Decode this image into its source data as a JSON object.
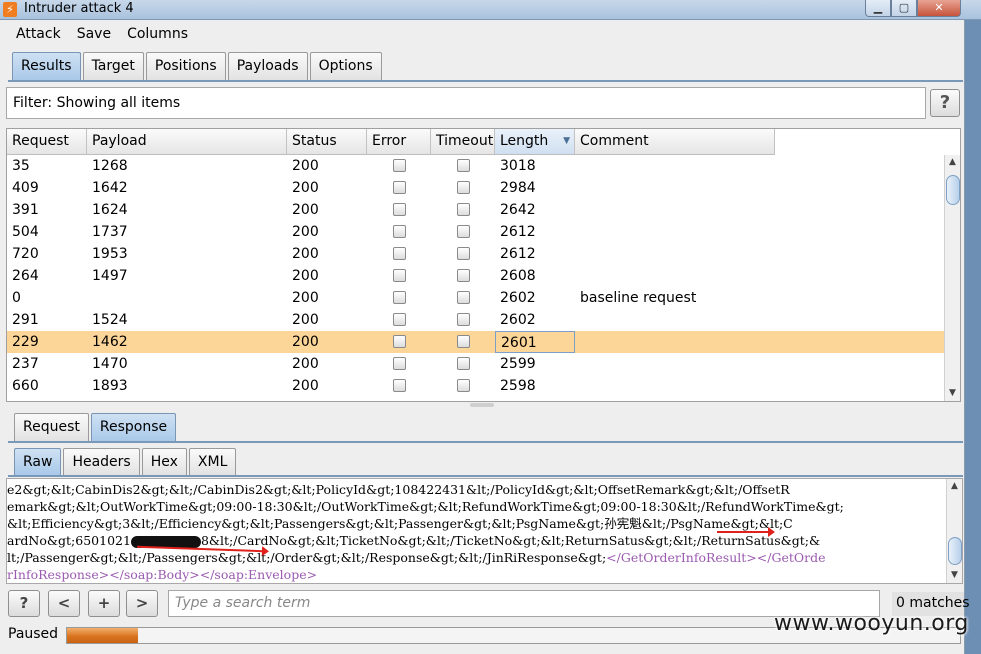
{
  "window": {
    "title": "Intruder attack 4",
    "app_icon": "burp-lightning-icon"
  },
  "menubar": [
    "Attack",
    "Save",
    "Columns"
  ],
  "top_tabs": [
    "Results",
    "Target",
    "Positions",
    "Payloads",
    "Options"
  ],
  "filter": {
    "text": "Filter: Showing all items",
    "help_label": "?"
  },
  "table": {
    "columns": [
      "Request",
      "Payload",
      "Status",
      "Error",
      "Timeout",
      "Length",
      "Comment"
    ],
    "sorted_column": "Length",
    "rows": [
      {
        "request": "35",
        "payload": "1268",
        "status": "200",
        "length": "3018",
        "comment": ""
      },
      {
        "request": "409",
        "payload": "1642",
        "status": "200",
        "length": "2984",
        "comment": ""
      },
      {
        "request": "391",
        "payload": "1624",
        "status": "200",
        "length": "2642",
        "comment": ""
      },
      {
        "request": "504",
        "payload": "1737",
        "status": "200",
        "length": "2612",
        "comment": ""
      },
      {
        "request": "720",
        "payload": "1953",
        "status": "200",
        "length": "2612",
        "comment": ""
      },
      {
        "request": "264",
        "payload": "1497",
        "status": "200",
        "length": "2608",
        "comment": ""
      },
      {
        "request": "0",
        "payload": "",
        "status": "200",
        "length": "2602",
        "comment": "baseline request"
      },
      {
        "request": "291",
        "payload": "1524",
        "status": "200",
        "length": "2602",
        "comment": ""
      },
      {
        "request": "229",
        "payload": "1462",
        "status": "200",
        "length": "2601",
        "comment": "",
        "selected": true
      },
      {
        "request": "237",
        "payload": "1470",
        "status": "200",
        "length": "2599",
        "comment": ""
      },
      {
        "request": "660",
        "payload": "1893",
        "status": "200",
        "length": "2598",
        "comment": ""
      }
    ]
  },
  "mid_tabs": [
    "Request",
    "Response"
  ],
  "sub_tabs": [
    "Raw",
    "Headers",
    "Hex",
    "XML"
  ],
  "response": {
    "line1": "e2&gt;&lt;CabinDis2&gt;&lt;/CabinDis2&gt;&lt;PolicyId&gt;108422431&lt;/PolicyId&gt;&lt;OffsetRemark&gt;&lt;/OffsetR",
    "line2": "emark&gt;&lt;OutWorkTime&gt;09:00-18:30&lt;/OutWorkTime&gt;&lt;RefundWorkTime&gt;09:00-18:30&lt;/RefundWorkTime&gt;",
    "line3": "&lt;Efficiency&gt;3&lt;/Efficiency&gt;&lt;Passengers&gt;&lt;Passenger&gt;&lt;PsgName&gt;孙宪魁&lt;/PsgName&gt;&lt;C",
    "line4a": "ardNo&gt;6501021",
    "line4b": "8&lt;/CardNo&gt;&lt;TicketNo&gt;&lt;/TicketNo&gt;&lt;ReturnSatus&gt;&lt;/ReturnSatus&gt;&",
    "line5a": "lt;/Passenger&gt;&lt;/Passengers&gt;&lt;/Order&gt;&lt;/Response&gt;&lt;/JinRiResponse&gt;",
    "line5b": "</GetOrderInfoResult></GetOrde",
    "line6": "rInfoResponse></soap:Body></soap:Envelope>"
  },
  "search": {
    "help_label": "?",
    "prev_label": "<",
    "add_label": "+",
    "next_label": ">",
    "placeholder": "Type a search term",
    "matches": "0 matches"
  },
  "status": {
    "text": "Paused",
    "progress": 0.08
  },
  "watermark": "www.wooyun.org",
  "colors": {
    "selected_row": "#fcd598",
    "active_tab": "#b9d3ee",
    "progress": "#d9731f"
  }
}
